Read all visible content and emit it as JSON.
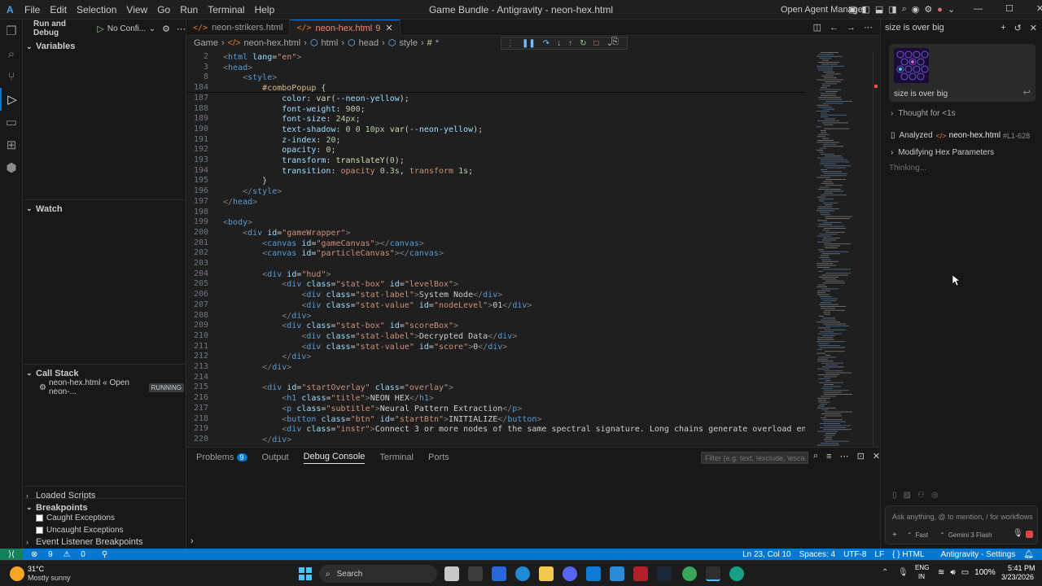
{
  "titlebar": {
    "menu": [
      "File",
      "Edit",
      "Selection",
      "View",
      "Go",
      "Run",
      "Terminal",
      "Help"
    ],
    "title": "Game Bundle - Antigravity - neon-hex.html",
    "open_agent_manager": "Open Agent Manager"
  },
  "sidebar": {
    "run_debug_label": "Run and Debug",
    "config_label": "No Confi...",
    "variables": "Variables",
    "watch": "Watch",
    "call_stack": "Call Stack",
    "call_stack_item": "neon-hex.html « Open neon-...",
    "running_badge": "RUNNING",
    "loaded_scripts": "Loaded Scripts",
    "breakpoints": "Breakpoints",
    "caught": "Caught Exceptions",
    "uncaught": "Uncaught Exceptions",
    "event_listener": "Event Listener Breakpoints"
  },
  "tabs": [
    {
      "label": "neon-strikers.html",
      "active": false
    },
    {
      "label": "neon-hex.html",
      "badge": "9",
      "active": true
    }
  ],
  "breadcrumb": [
    "Game",
    "neon-hex.html",
    "html",
    "head",
    "style",
    "*"
  ],
  "code_lines": [
    {
      "n": "2",
      "html": "<span class='p'>&lt;</span><span class='t'>html</span> <span class='a'>lang</span>=<span class='s'>\"en\"</span><span class='p'>&gt;</span>"
    },
    {
      "n": "3",
      "html": "<span class='p'>&lt;</span><span class='t'>head</span><span class='p'>&gt;</span>"
    },
    {
      "n": "8",
      "html": "    <span class='p'>&lt;</span><span class='t'>style</span><span class='p'>&gt;</span>"
    },
    {
      "n": "184",
      "html": "        <span class='sel'>#comboPopup</span> {"
    },
    {
      "n": "187",
      "html": "            <span class='prop'>color</span>: <span class='fn'>var</span>(<span class='a'>--neon-yellow</span>);"
    },
    {
      "n": "188",
      "html": "            <span class='prop'>font-weight</span>: <span class='num'>900</span>;"
    },
    {
      "n": "189",
      "html": "            <span class='prop'>font-size</span>: <span class='num'>24px</span>;"
    },
    {
      "n": "190",
      "html": "            <span class='prop'>text-shadow</span>: <span class='num'>0 0 10px</span> <span class='fn'>var</span>(<span class='a'>--neon-yellow</span>);"
    },
    {
      "n": "191",
      "html": "            <span class='prop'>z-index</span>: <span class='num'>20</span>;"
    },
    {
      "n": "192",
      "html": "            <span class='prop'>opacity</span>: <span class='num'>0</span>;"
    },
    {
      "n": "193",
      "html": "            <span class='prop'>transform</span>: <span class='fn'>translateY</span>(<span class='num'>0</span>);"
    },
    {
      "n": "194",
      "html": "            <span class='prop'>transition</span>: <span class='val'>opacity</span> <span class='num'>0.3s</span>, <span class='val'>transform</span> <span class='num'>1s</span>;"
    },
    {
      "n": "195",
      "html": "        }"
    },
    {
      "n": "196",
      "html": "    <span class='p'>&lt;/</span><span class='t'>style</span><span class='p'>&gt;</span>"
    },
    {
      "n": "197",
      "html": "<span class='p'>&lt;/</span><span class='t'>head</span><span class='p'>&gt;</span>"
    },
    {
      "n": "198",
      "html": ""
    },
    {
      "n": "199",
      "html": "<span class='p'>&lt;</span><span class='t'>body</span><span class='p'>&gt;</span>"
    },
    {
      "n": "200",
      "html": "    <span class='p'>&lt;</span><span class='t'>div</span> <span class='a'>id</span>=<span class='s'>\"gameWrapper\"</span><span class='p'>&gt;</span>"
    },
    {
      "n": "201",
      "html": "        <span class='p'>&lt;</span><span class='t'>canvas</span> <span class='a'>id</span>=<span class='s'>\"gameCanvas\"</span><span class='p'>&gt;&lt;/</span><span class='t'>canvas</span><span class='p'>&gt;</span>"
    },
    {
      "n": "202",
      "html": "        <span class='p'>&lt;</span><span class='t'>canvas</span> <span class='a'>id</span>=<span class='s'>\"particleCanvas\"</span><span class='p'>&gt;&lt;/</span><span class='t'>canvas</span><span class='p'>&gt;</span>"
    },
    {
      "n": "203",
      "html": ""
    },
    {
      "n": "204",
      "html": "        <span class='p'>&lt;</span><span class='t'>div</span> <span class='a'>id</span>=<span class='s'>\"hud\"</span><span class='p'>&gt;</span>"
    },
    {
      "n": "205",
      "html": "            <span class='p'>&lt;</span><span class='t'>div</span> <span class='a'>class</span>=<span class='s'>\"stat-box\"</span> <span class='a'>id</span>=<span class='s'>\"levelBox\"</span><span class='p'>&gt;</span>"
    },
    {
      "n": "206",
      "html": "                <span class='p'>&lt;</span><span class='t'>div</span> <span class='a'>class</span>=<span class='s'>\"stat-label\"</span><span class='p'>&gt;</span>System Node<span class='p'>&lt;/</span><span class='t'>div</span><span class='p'>&gt;</span>"
    },
    {
      "n": "207",
      "html": "                <span class='p'>&lt;</span><span class='t'>div</span> <span class='a'>class</span>=<span class='s'>\"stat-value\"</span> <span class='a'>id</span>=<span class='s'>\"nodeLevel\"</span><span class='p'>&gt;</span>01<span class='p'>&lt;/</span><span class='t'>div</span><span class='p'>&gt;</span>"
    },
    {
      "n": "208",
      "html": "            <span class='p'>&lt;/</span><span class='t'>div</span><span class='p'>&gt;</span>"
    },
    {
      "n": "209",
      "html": "            <span class='p'>&lt;</span><span class='t'>div</span> <span class='a'>class</span>=<span class='s'>\"stat-box\"</span> <span class='a'>id</span>=<span class='s'>\"scoreBox\"</span><span class='p'>&gt;</span>"
    },
    {
      "n": "210",
      "html": "                <span class='p'>&lt;</span><span class='t'>div</span> <span class='a'>class</span>=<span class='s'>\"stat-label\"</span><span class='p'>&gt;</span>Decrypted Data<span class='p'>&lt;/</span><span class='t'>div</span><span class='p'>&gt;</span>"
    },
    {
      "n": "211",
      "html": "                <span class='p'>&lt;</span><span class='t'>div</span> <span class='a'>class</span>=<span class='s'>\"stat-value\"</span> <span class='a'>id</span>=<span class='s'>\"score\"</span><span class='p'>&gt;</span>0<span class='p'>&lt;/</span><span class='t'>div</span><span class='p'>&gt;</span>"
    },
    {
      "n": "212",
      "html": "            <span class='p'>&lt;/</span><span class='t'>div</span><span class='p'>&gt;</span>"
    },
    {
      "n": "213",
      "html": "        <span class='p'>&lt;/</span><span class='t'>div</span><span class='p'>&gt;</span>"
    },
    {
      "n": "214",
      "html": ""
    },
    {
      "n": "215",
      "html": "        <span class='p'>&lt;</span><span class='t'>div</span> <span class='a'>id</span>=<span class='s'>\"startOverlay\"</span> <span class='a'>class</span>=<span class='s'>\"overlay\"</span><span class='p'>&gt;</span>"
    },
    {
      "n": "216",
      "html": "            <span class='p'>&lt;</span><span class='t'>h1</span> <span class='a'>class</span>=<span class='s'>\"title\"</span><span class='p'>&gt;</span>NEON HEX<span class='p'>&lt;/</span><span class='t'>h1</span><span class='p'>&gt;</span>"
    },
    {
      "n": "217",
      "html": "            <span class='p'>&lt;</span><span class='t'>p</span> <span class='a'>class</span>=<span class='s'>\"subtitle\"</span><span class='p'>&gt;</span>Neural Pattern Extraction<span class='p'>&lt;/</span><span class='t'>p</span><span class='p'>&gt;</span>"
    },
    {
      "n": "218",
      "html": "            <span class='p'>&lt;</span><span class='t'>button</span> <span class='a'>class</span>=<span class='s'>\"btn\"</span> <span class='a'>id</span>=<span class='s'>\"startBtn\"</span><span class='p'>&gt;</span>INITIALIZE<span class='p'>&lt;/</span><span class='t'>button</span><span class='p'>&gt;</span>"
    },
    {
      "n": "219",
      "html": "            <span class='p'>&lt;</span><span class='t'>div</span> <span class='a'>class</span>=<span class='s'>\"instr\"</span><span class='p'>&gt;</span>Connect 3 or more nodes of the same spectral signature. Long chains generate overload energy. Precision is ke"
    },
    {
      "n": "220",
      "html": "        <span class='p'>&lt;/</span><span class='t'>div</span><span class='p'>&gt;</span>"
    }
  ],
  "panel": {
    "tabs": [
      "Problems",
      "Output",
      "Debug Console",
      "Terminal",
      "Ports"
    ],
    "problems_count": "9",
    "filter_placeholder": "Filter (e.g. text, !exclude, \\esca..."
  },
  "agent": {
    "header_title": "size is over big",
    "user_message": "size is over big",
    "thought": "Thought for <1s",
    "analyzed_label": "Analyzed",
    "analyzed_file": "neon-hex.html",
    "analyzed_range": "#L1-628",
    "modifying": "Modifying Hex Parameters",
    "thinking": "Thinking...",
    "input_placeholder": "Ask anything, @ to mention, / for workflows",
    "mode": "Fast",
    "model": "Gemini 3 Flash"
  },
  "statusbar": {
    "errors": "9",
    "warnings": "0",
    "position": "Ln 23, Col 10",
    "spaces": "Spaces: 4",
    "encoding": "UTF-8",
    "eol": "LF",
    "language": "HTML",
    "settings": "Antigravity - Settings"
  },
  "taskbar": {
    "temperature": "31°C",
    "weather": "Mostly sunny",
    "search": "Search",
    "lang": "ENG",
    "region": "IN",
    "battery": "100%",
    "time": "5:41 PM",
    "date": "3/23/2026"
  }
}
